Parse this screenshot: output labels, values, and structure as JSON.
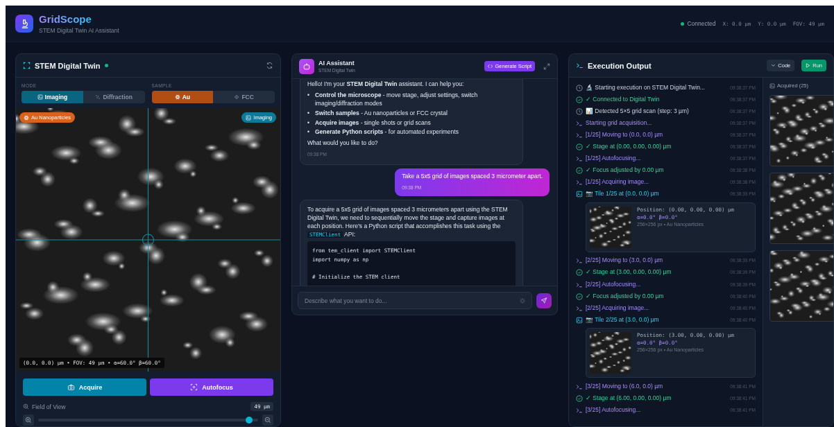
{
  "header": {
    "app_name": "GridScope",
    "subtitle": "STEM Digital Twin AI Assistant",
    "status": {
      "label": "Connected",
      "connected": true
    },
    "readouts": [
      "X: 0.0 µm",
      "Y: 0.0 µm",
      "FOV: 49 µm"
    ]
  },
  "twin_panel": {
    "title": "STEM Digital Twin",
    "online": true,
    "mode": {
      "label": "MODE",
      "options": [
        {
          "label": "Imaging",
          "selected": true
        },
        {
          "label": "Diffraction",
          "selected": false
        }
      ]
    },
    "sample": {
      "label": "SAMPLE",
      "options": [
        {
          "label": "Au",
          "selected": true
        },
        {
          "label": "FCC",
          "selected": false
        }
      ]
    },
    "viewer": {
      "sample_badge": "Au Nanoparticles",
      "mode_badge": "Imaging",
      "caption": "(0.0, 0.0) µm • FOV: 49 µm • α=60.0° β=60.0°"
    },
    "actions": [
      {
        "label": "Acquire",
        "kind": "acquire"
      },
      {
        "label": "Autofocus",
        "kind": "autofocus"
      }
    ],
    "fov": {
      "label": "Field of View",
      "value": "49 µm",
      "level": 0.96
    }
  },
  "chat": {
    "title": "AI Assistant",
    "subtitle": "STEM Digital Twin",
    "generate_button": "Generate Script",
    "messages": [
      {
        "kind": "assistant",
        "intro": "Hello! I'm your **STEM Digital Twin** assistant. I can help you:",
        "bullets": [
          {
            "marker": "•",
            "text": "**Control the microscope** - move stage, adjust settings, switch imaging/diffraction modes"
          },
          {
            "marker": "•",
            "text": "**Switch samples** - Au nanoparticles or FCC crystal"
          },
          {
            "marker": "•",
            "text": "**Acquire images** - single shots or grid scans"
          },
          {
            "marker": "•",
            "text": "**Generate Python scripts** - for automated experiments"
          }
        ],
        "outro": "What would you like to do?",
        "time": "09:38 PM"
      },
      {
        "kind": "user",
        "text": "Take a 5x5 grid of images spaced 3 micrometer apart.",
        "time": "09:38 PM"
      },
      {
        "kind": "assistant",
        "text_before": "To acquire a 5x5 grid of images spaced 3 micrometers apart using the STEM Digital Twin, we need to sequentially move the stage and capture images at each position. Here's a Python script that accomplishes this task using the",
        "inline_code": "STEMClient",
        "text_after": "API:",
        "code": [
          [
            "from tem_client import STEMClient",
            "import numpy as np"
          ],
          [
            "# Initialize the STEM client"
          ]
        ]
      }
    ],
    "input": {
      "placeholder": "Describe what you want to do..."
    }
  },
  "output": {
    "title": "Execution Output",
    "buttons": [
      {
        "label": "Code",
        "kind": "toggle"
      },
      {
        "label": "Run",
        "kind": "run"
      }
    ],
    "log": [
      {
        "kind": "info",
        "text": "🔬 Starting execution on STEM Digital Twin...",
        "time": "09:38:37 PM"
      },
      {
        "kind": "success",
        "text": "✓ Connected to Digital Twin",
        "time": "09:38:37 PM"
      },
      {
        "kind": "info",
        "text": "📊 Detected 5×5 grid scan (step: 3 µm)",
        "time": "09:38:37 PM"
      },
      {
        "kind": "command",
        "text": "Starting grid acquisition...",
        "time": "09:38:37 PM"
      },
      {
        "kind": "command",
        "text": "[1/25] Moving to (0.0, 0.0) µm",
        "time": "09:38:37 PM"
      },
      {
        "kind": "success",
        "text": "✓ Stage at (0.00, 0.00, 0.00) µm",
        "time": "09:38:37 PM"
      },
      {
        "kind": "command",
        "text": "[1/25] Autofocusing...",
        "time": "09:38:37 PM"
      },
      {
        "kind": "success",
        "text": "✓ Focus adjusted by 0.00 µm",
        "time": "09:38:38 PM"
      },
      {
        "kind": "command",
        "text": "[1/25] Acquiring image...",
        "time": "09:38:38 PM"
      },
      {
        "kind": "image",
        "text": "📷 Tile 1/25 at (0.0, 0.0) µm",
        "time": "09:38:39 PM",
        "tile": {
          "position": "Position: (0.00, 0.00, 0.00) µm",
          "angles": "α=0.0° β=0.0°",
          "meta": "256×256 px • Au Nanoparticles"
        }
      },
      {
        "kind": "command",
        "text": "[2/25] Moving to (3.0, 0.0) µm",
        "time": "09:38:39 PM"
      },
      {
        "kind": "success",
        "text": "✓ Stage at (3.00, 0.00, 0.00) µm",
        "time": "09:38:39 PM"
      },
      {
        "kind": "command",
        "text": "[2/25] Autofocusing...",
        "time": "09:38:39 PM"
      },
      {
        "kind": "success",
        "text": "✓ Focus adjusted by 0.00 µm",
        "time": "09:38:40 PM"
      },
      {
        "kind": "command",
        "text": "[2/25] Acquiring image...",
        "time": "09:38:40 PM"
      },
      {
        "kind": "image",
        "text": "📷 Tile 2/25 at (3.0, 0.0) µm",
        "time": "09:38:40 PM",
        "tile": {
          "position": "Position: (3.00, 0.00, 0.00) µm",
          "angles": "α=0.0° β=0.0°",
          "meta": "256×256 px • Au Nanoparticles"
        }
      },
      {
        "kind": "command",
        "text": "[3/25] Moving to (6.0, 0.0) µm",
        "time": "09:38:41 PM"
      },
      {
        "kind": "success",
        "text": "✓ Stage at (6.00, 0.00, 0.00) µm",
        "time": "09:38:41 PM"
      },
      {
        "kind": "command",
        "text": "[3/25] Autofocusing...",
        "time": "09:38:41 PM"
      }
    ],
    "gallery": {
      "label": "Acquired (25)"
    }
  }
}
